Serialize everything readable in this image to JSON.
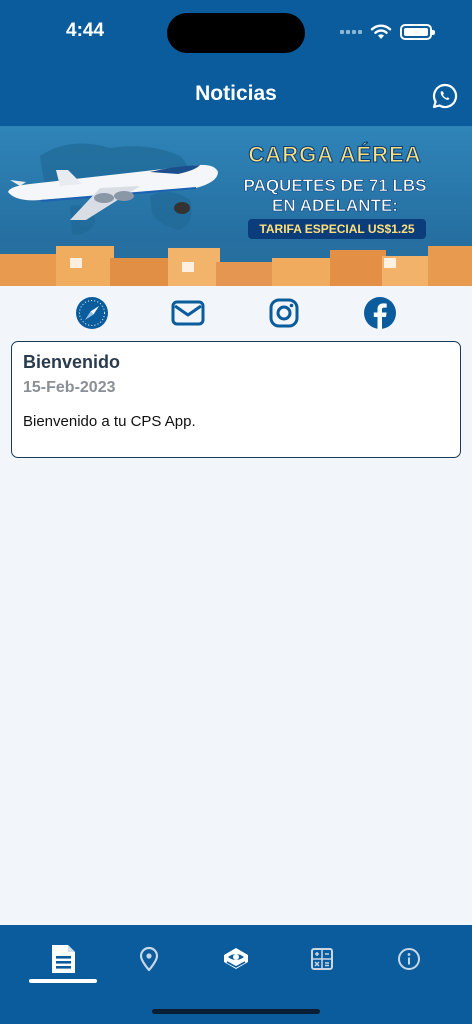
{
  "status_bar": {
    "time": "4:44"
  },
  "header": {
    "title": "Noticias"
  },
  "banner": {
    "line1": "CARGA AÉREA",
    "line2a": "PAQUETES DE 71 LBS",
    "line2b": "EN ADELANTE:",
    "line3": "TARIFA ESPECIAL US$1.25"
  },
  "socials": [
    "compass-icon",
    "mail-icon",
    "instagram-icon",
    "facebook-icon"
  ],
  "news": [
    {
      "title": "Bienvenido",
      "date": "15-Feb-2023",
      "body": "Bienvenido a tu CPS App."
    }
  ],
  "tabs": [
    {
      "icon": "news-icon",
      "active": true
    },
    {
      "icon": "location-pin-icon",
      "active": false
    },
    {
      "icon": "logo-icon",
      "active": false
    },
    {
      "icon": "calculator-icon",
      "active": false
    },
    {
      "icon": "info-icon",
      "active": false
    }
  ],
  "colors": {
    "primary": "#0a5c9c",
    "background": "#f2f5f9",
    "card_border": "#1b3a55",
    "date_gray": "#8a8f95"
  }
}
